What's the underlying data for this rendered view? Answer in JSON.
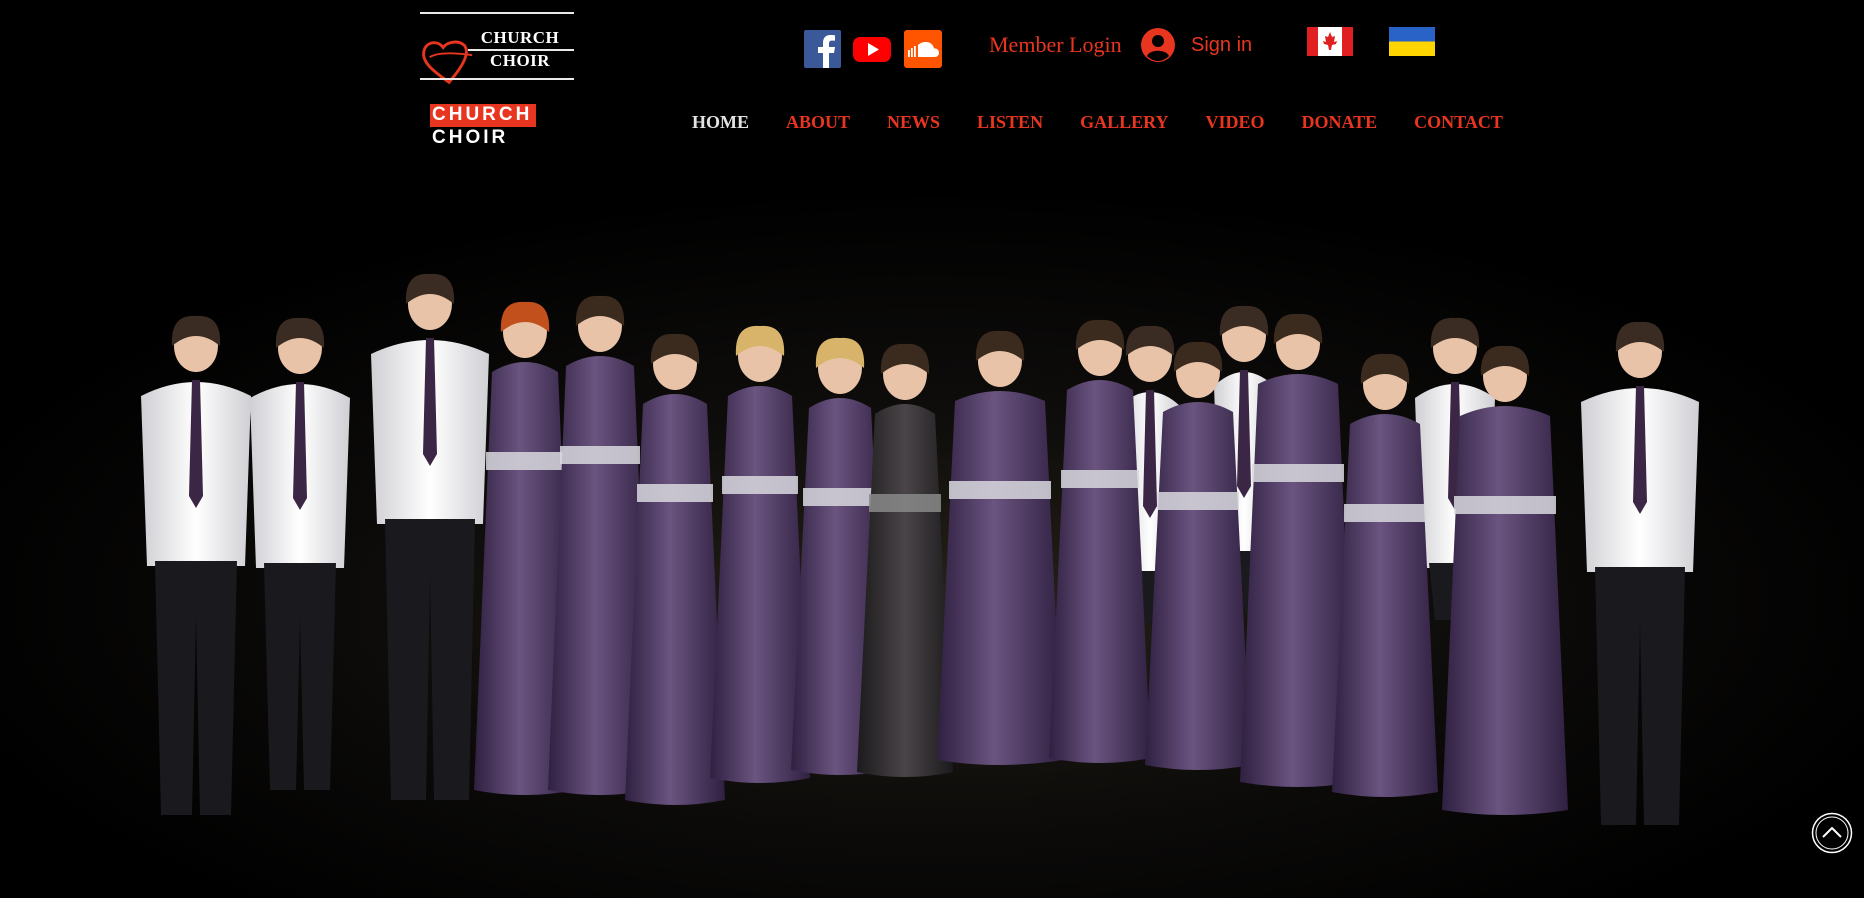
{
  "logo": {
    "line1": "CHURCH",
    "line2": "CHOIR",
    "sub_word1": "CHURCH",
    "sub_word2": "CHOIR"
  },
  "social": [
    {
      "name": "Facebook",
      "icon": "facebook-icon",
      "color": "#3b5998"
    },
    {
      "name": "YouTube",
      "icon": "youtube-icon",
      "color": "#ff0000"
    },
    {
      "name": "SoundCloud",
      "icon": "soundcloud-icon",
      "color": "#ff5500"
    }
  ],
  "header": {
    "member_login": "Member Login",
    "sign_in": "Sign in"
  },
  "languages": [
    {
      "name": "Canada",
      "icon": "canada-flag-icon"
    },
    {
      "name": "Ukraine",
      "icon": "ukraine-flag-icon"
    }
  ],
  "nav": {
    "items": [
      "HOME",
      "ABOUT",
      "NEWS",
      "LISTEN",
      "GALLERY",
      "VIDEO",
      "DONATE",
      "CONTACT"
    ],
    "active": "HOME"
  },
  "colors": {
    "accent": "#e8351f",
    "background": "#000000",
    "active_nav": "#e3e3e3",
    "gown": "#4a3658",
    "shirt": "#f2f2f2"
  },
  "hero": {
    "icon": "choir-group-photo"
  }
}
